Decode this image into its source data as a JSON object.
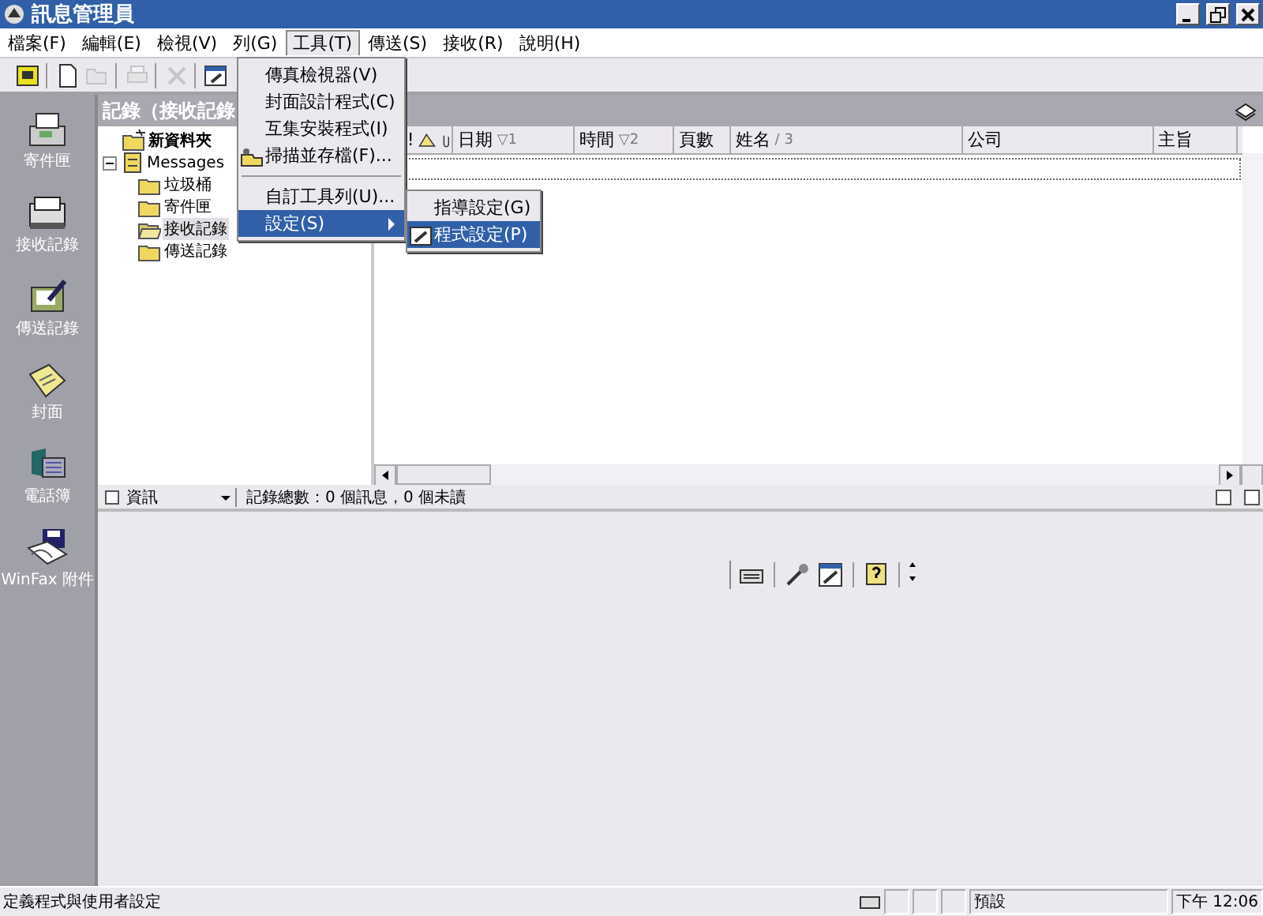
{
  "window": {
    "title": "訊息管理員"
  },
  "menu_bar": [
    {
      "label": "檔案(F)",
      "selected": false
    },
    {
      "label": "編輯(E)",
      "selected": false
    },
    {
      "label": "檢視(V)",
      "selected": false
    },
    {
      "label": "列(G)",
      "selected": false
    },
    {
      "label": "工具(T)",
      "selected": true
    },
    {
      "label": "傳送(S)",
      "selected": false
    },
    {
      "label": "接收(R)",
      "selected": false
    },
    {
      "label": "說明(H)",
      "selected": false
    }
  ],
  "toolbar": [
    {
      "kind": "fax",
      "disabled": false
    },
    {
      "kind": "new",
      "disabled": false
    },
    {
      "kind": "open",
      "disabled": true
    },
    {
      "kind": "print",
      "disabled": true
    },
    {
      "kind": "delete",
      "disabled": true
    },
    {
      "kind": "properties",
      "disabled": false
    }
  ],
  "open_menu": {
    "items": [
      {
        "label": "傳真檢視器(V)",
        "kind": "item",
        "selected": false
      },
      {
        "label": "封面設計程式(C)",
        "kind": "item",
        "selected": false
      },
      {
        "label": "互集安裝程式(I)",
        "kind": "item",
        "selected": false
      },
      {
        "label": "掃描並存檔(F)...",
        "kind": "icon-item",
        "selected": false
      },
      {
        "label": "自訂工具列(U)...",
        "kind": "separated",
        "selected": false
      },
      {
        "label": "設定(S)",
        "kind": "submenu",
        "selected": true
      }
    ],
    "submenu": {
      "items": [
        {
          "label": "指導設定(G)",
          "selected": false
        },
        {
          "label": "程式設定(P)",
          "selected": true
        }
      ]
    }
  },
  "sidebar": {
    "items": [
      {
        "label": "寄件匣",
        "kind": "fax"
      },
      {
        "label": "接收記錄",
        "kind": "scanner"
      },
      {
        "label": "傳送記錄",
        "kind": "log"
      },
      {
        "label": "封面",
        "kind": "cover"
      },
      {
        "label": "電話簿",
        "kind": "phonebook"
      },
      {
        "label": "WinFax 附件",
        "kind": "attachment"
      }
    ]
  },
  "pane_title": "記錄（接收記錄",
  "tree": [
    {
      "label": "新資料夾",
      "bold": true,
      "selected": false
    },
    {
      "label": "Messages",
      "bold": false,
      "selected": false,
      "expanded": true,
      "children": [
        {
          "label": "垃圾桶",
          "selected": false
        },
        {
          "label": "寄件匣",
          "selected": false
        },
        {
          "label": "接收記錄",
          "selected": true
        },
        {
          "label": "傳送記錄",
          "selected": false
        }
      ]
    }
  ],
  "table": {
    "columns": [
      {
        "label": "!"
      },
      {
        "label": "日期",
        "sort": "▽1"
      },
      {
        "label": "時間",
        "sort": "▽2"
      },
      {
        "label": "頁數"
      },
      {
        "label": "姓名",
        "sort": "/ 3"
      },
      {
        "label": "公司"
      },
      {
        "label": "主旨"
      }
    ]
  },
  "info": {
    "dropdown": "資訊",
    "summary": "記錄總數：0 個訊息，0 個未讀"
  },
  "status_bar": {
    "message": "定義程式與使用者設定",
    "profile": "預設",
    "time": "下午 12:06"
  }
}
